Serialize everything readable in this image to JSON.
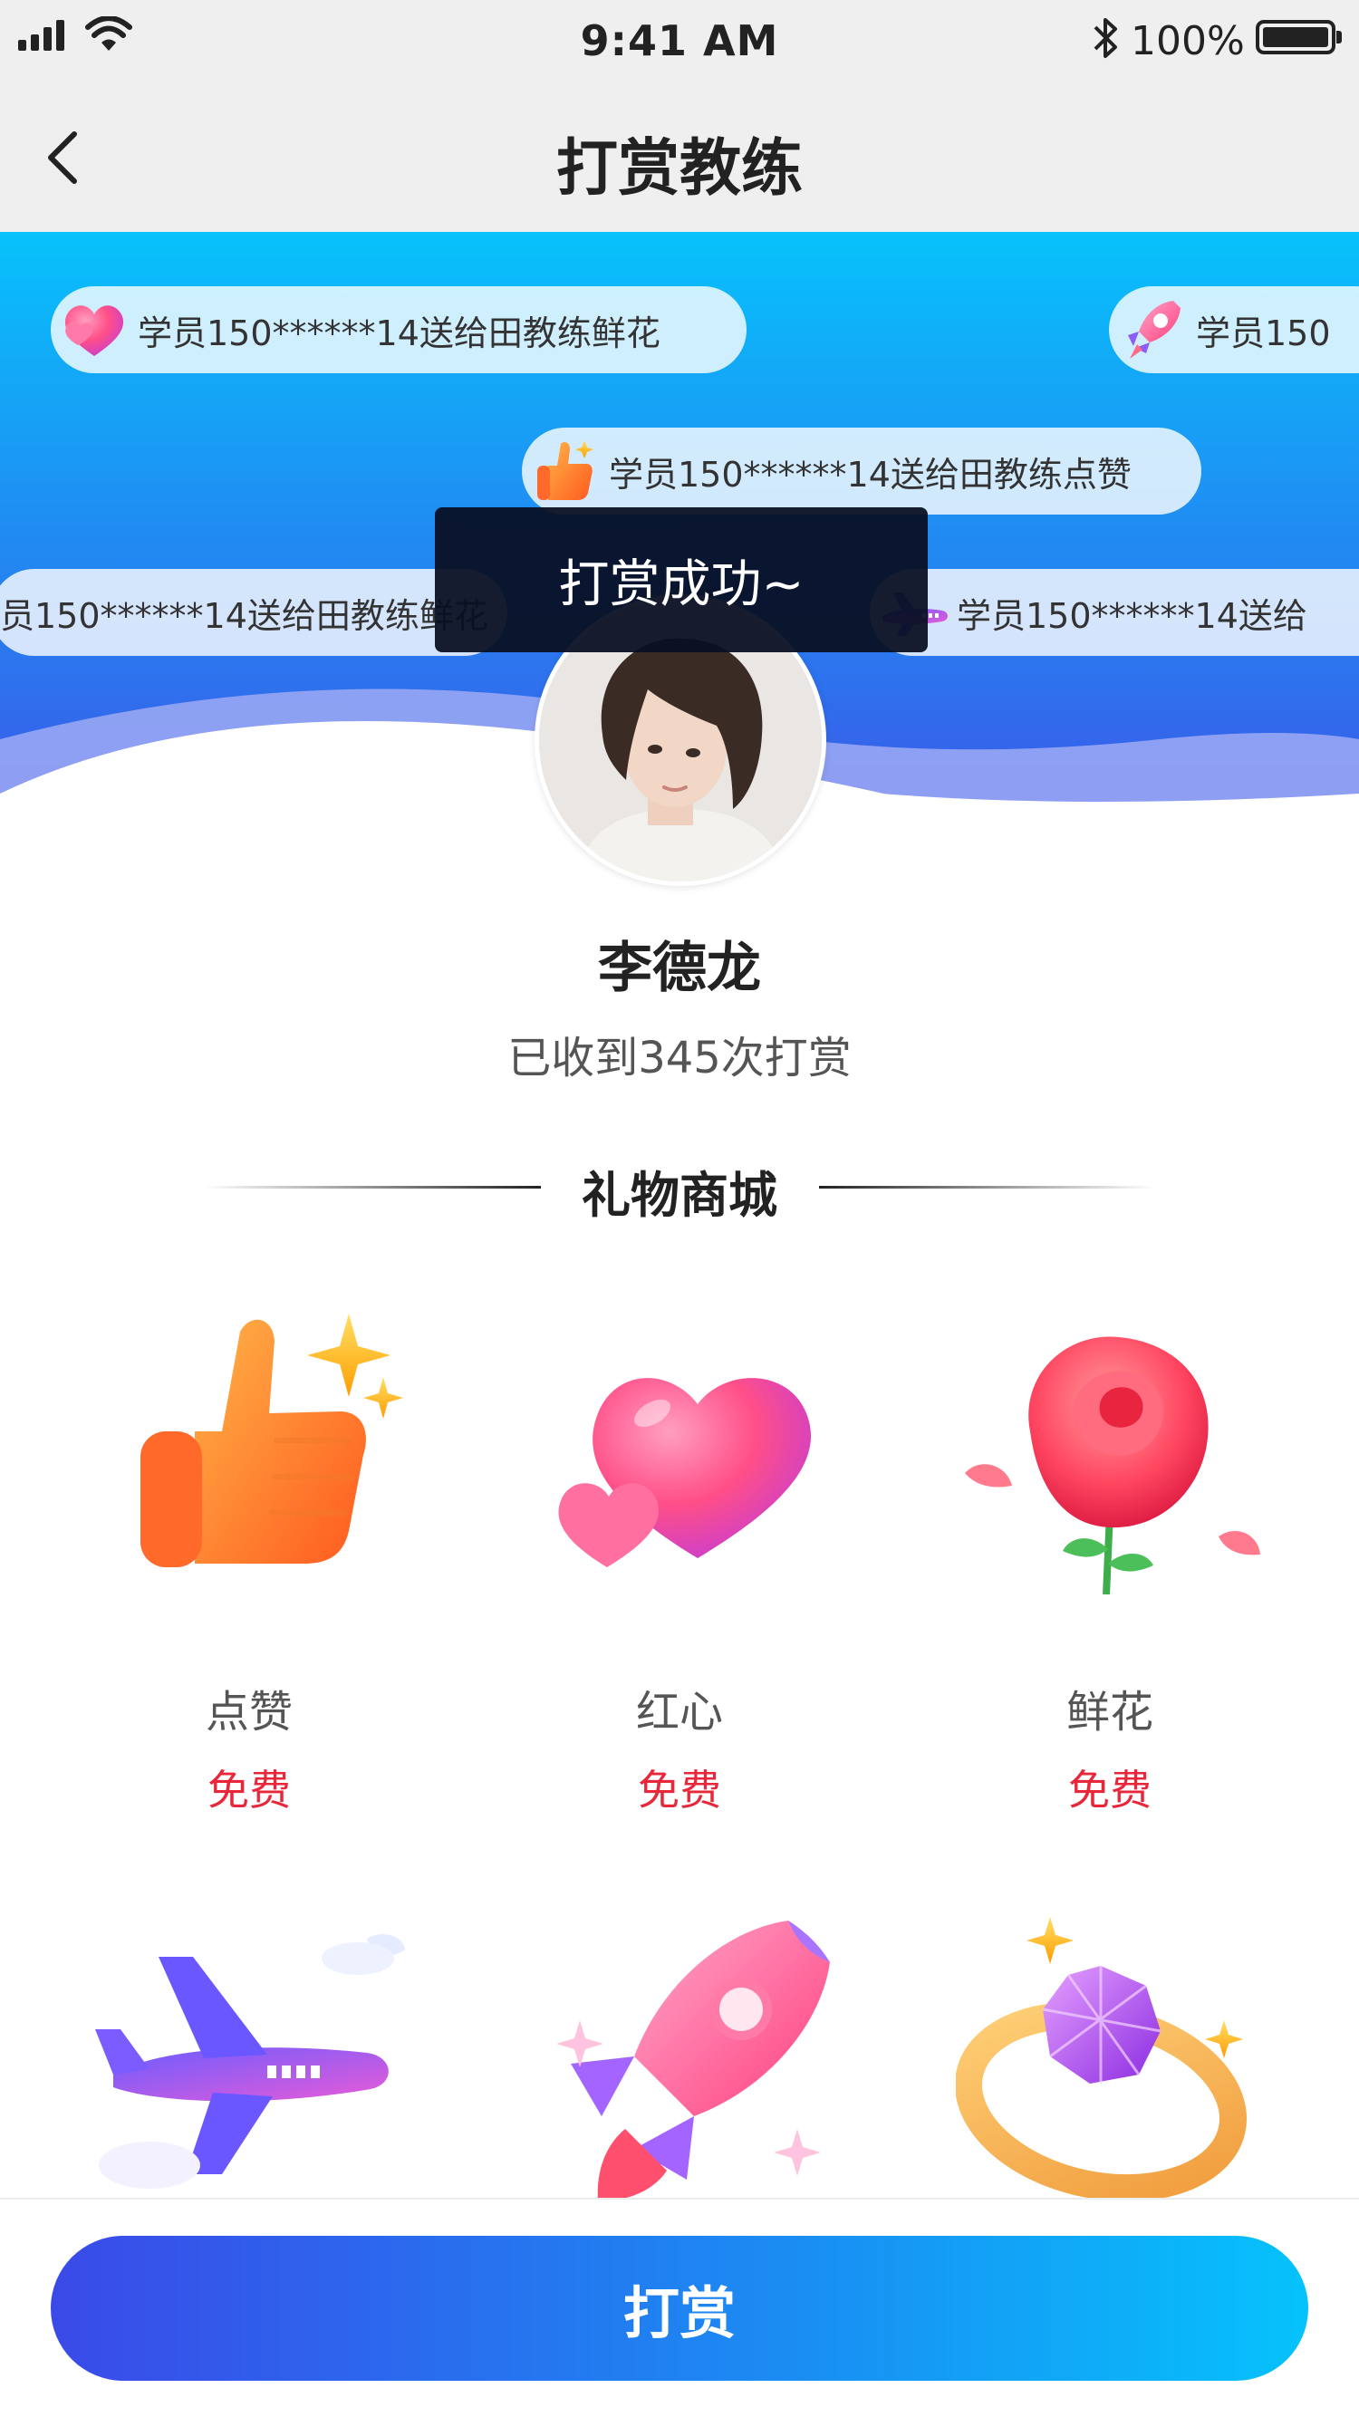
{
  "status_bar": {
    "time": "9:41 AM",
    "battery": "100%"
  },
  "nav": {
    "title": "打赏教练"
  },
  "barrage": [
    {
      "icon": "heart-icon",
      "text": "学员150******14送给田教练鲜花"
    },
    {
      "icon": "rocket-icon",
      "text": "学员150"
    },
    {
      "icon": "thumbs-up-icon",
      "text": "学员150******14送给田教练点赞"
    },
    {
      "icon": "none",
      "text": "员150******14送给田教练鲜花"
    },
    {
      "icon": "airplane-icon",
      "text": "学员150******14送给"
    }
  ],
  "toast": {
    "text": "打赏成功~"
  },
  "coach": {
    "name": "李德龙",
    "received": "已收到345次打赏"
  },
  "section": {
    "title": "礼物商城"
  },
  "gifts": [
    {
      "icon": "thumbs-up-icon",
      "name": "点赞",
      "price": "免费"
    },
    {
      "icon": "heart-icon",
      "name": "红心",
      "price": "免费"
    },
    {
      "icon": "rose-icon",
      "name": "鲜花",
      "price": "免费"
    },
    {
      "icon": "airplane-icon"
    },
    {
      "icon": "rocket-icon"
    },
    {
      "icon": "diamond-ring-icon"
    }
  ],
  "action": {
    "submit_label": "打赏"
  }
}
